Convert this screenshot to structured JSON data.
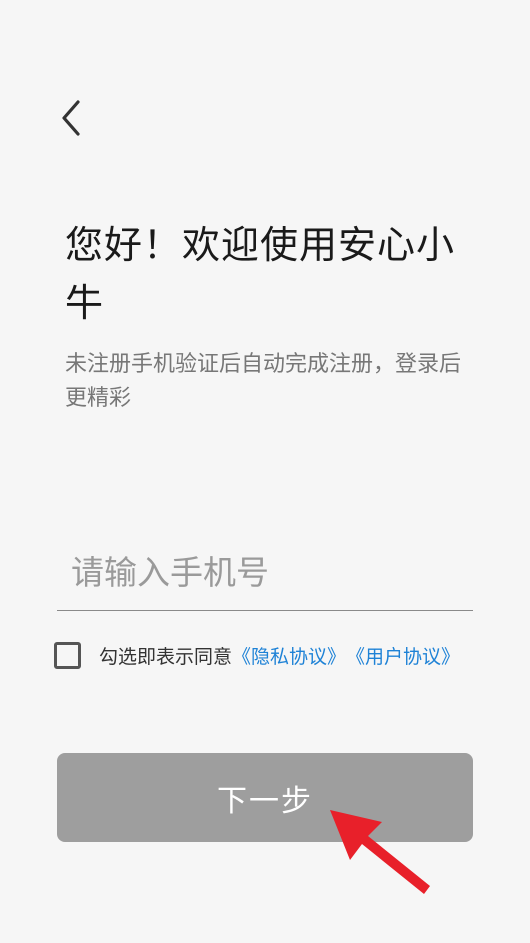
{
  "header": {
    "back_icon": "chevron-left-icon"
  },
  "welcome": {
    "title": "您好！欢迎使用安心小牛",
    "subtitle": "未注册手机验证后自动完成注册，登录后更精彩"
  },
  "phone": {
    "value": "",
    "placeholder": "请输入手机号"
  },
  "agreement": {
    "checked": false,
    "prefix": "勾选即表示同意",
    "privacy_link": "《隐私协议》",
    "user_link": "《用户协议》",
    "link_color": "#1e82d6"
  },
  "actions": {
    "next_label": "下一步",
    "next_bg": "#9e9e9e"
  },
  "annotation": {
    "icon": "red-arrow-icon",
    "color": "#e8202a"
  }
}
